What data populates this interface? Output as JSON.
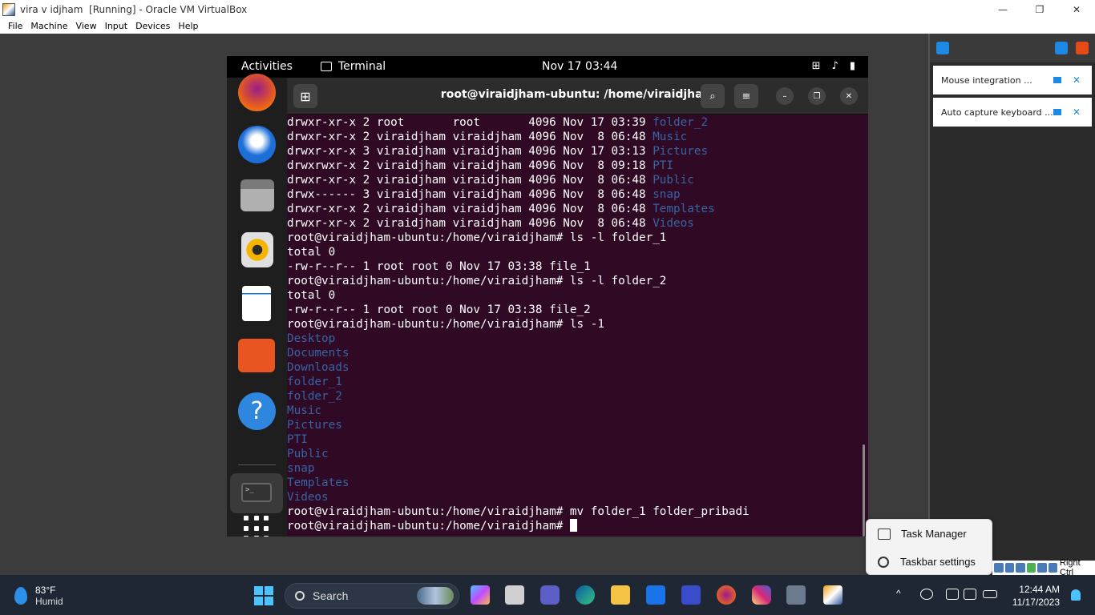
{
  "window": {
    "title": "vira v idjham  [Running] - Oracle VM VirtualBox",
    "controls": [
      "—",
      "❐",
      "✕"
    ]
  },
  "menu": [
    "File",
    "Machine",
    "View",
    "Input",
    "Devices",
    "Help"
  ],
  "side_panel": {
    "notifications": [
      "Mouse integration ...",
      "Auto capture keyboard ..."
    ]
  },
  "ubuntu_topbar": {
    "activities": "Activities",
    "app": "Terminal",
    "clock": "Nov 17  03:44"
  },
  "dock": {
    "terminal_prompt": ">_",
    "icons": [
      "firefox-icon",
      "thunderbird-icon",
      "files-icon",
      "rhythmbox-icon",
      "writer-icon",
      "software-icon",
      "help-icon"
    ]
  },
  "terminal": {
    "title": "root@viraidjham-ubuntu: /home/viraidjham",
    "lines": [
      {
        "text": "drwxr-xr-x 2 root       root       4096 Nov 17 03:39 ",
        "dir": "folder_2"
      },
      {
        "text": "drwxr-xr-x 2 viraidjham viraidjham 4096 Nov  8 06:48 ",
        "dir": "Music"
      },
      {
        "text": "drwxr-xr-x 3 viraidjham viraidjham 4096 Nov 17 03:13 ",
        "dir": "Pictures"
      },
      {
        "text": "drwxrwxr-x 2 viraidjham viraidjham 4096 Nov  8 09:18 ",
        "dir": "PTI"
      },
      {
        "text": "drwxr-xr-x 2 viraidjham viraidjham 4096 Nov  8 06:48 ",
        "dir": "Public"
      },
      {
        "text": "drwx------ 3 viraidjham viraidjham 4096 Nov  8 06:48 ",
        "dir": "snap"
      },
      {
        "text": "drwxr-xr-x 2 viraidjham viraidjham 4096 Nov  8 06:48 ",
        "dir": "Templates"
      },
      {
        "text": "drwxr-xr-x 2 viraidjham viraidjham 4096 Nov  8 06:48 ",
        "dir": "Videos"
      },
      {
        "text": "root@viraidjham-ubuntu:/home/viraidjham# ls -l folder_1",
        "dir": ""
      },
      {
        "text": "total 0",
        "dir": ""
      },
      {
        "text": "-rw-r--r-- 1 root root 0 Nov 17 03:38 file_1",
        "dir": ""
      },
      {
        "text": "root@viraidjham-ubuntu:/home/viraidjham# ls -l folder_2",
        "dir": ""
      },
      {
        "text": "total 0",
        "dir": ""
      },
      {
        "text": "-rw-r--r-- 1 root root 0 Nov 17 03:38 file_2",
        "dir": ""
      },
      {
        "text": "root@viraidjham-ubuntu:/home/viraidjham# ls -1",
        "dir": ""
      },
      {
        "text": "",
        "dir": "Desktop"
      },
      {
        "text": "",
        "dir": "Documents"
      },
      {
        "text": "",
        "dir": "Downloads"
      },
      {
        "text": "",
        "dir": "folder_1"
      },
      {
        "text": "",
        "dir": "folder_2"
      },
      {
        "text": "",
        "dir": "Music"
      },
      {
        "text": "",
        "dir": "Pictures"
      },
      {
        "text": "",
        "dir": "PTI"
      },
      {
        "text": "",
        "dir": "Public"
      },
      {
        "text": "",
        "dir": "snap"
      },
      {
        "text": "",
        "dir": "Templates"
      },
      {
        "text": "",
        "dir": "Videos"
      },
      {
        "text": "root@viraidjham-ubuntu:/home/viraidjham# mv folder_1 folder_pribadi",
        "dir": ""
      }
    ],
    "prompt": "root@viraidjham-ubuntu:/home/viraidjham# ",
    "dir_color": "#3465a4",
    "bg_color": "#300a24"
  },
  "context_menu": [
    "Task Manager",
    "Taskbar settings"
  ],
  "vbox_status": {
    "host_key": "Right Ctrl"
  },
  "taskbar": {
    "weather_temp": "83°F",
    "weather_desc": "Humid",
    "search": "Search",
    "time": "12:44 AM",
    "date": "11/17/2023",
    "accent": "#4cc2ff"
  }
}
